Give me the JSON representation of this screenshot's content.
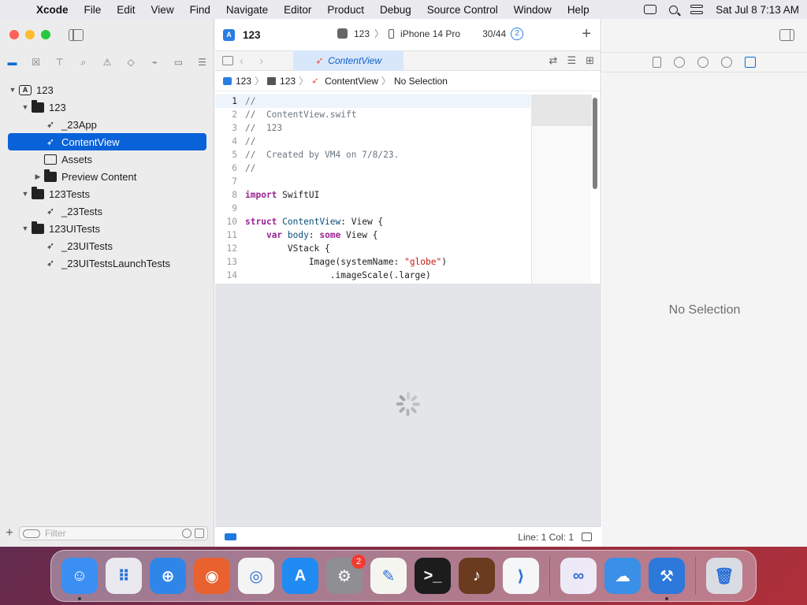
{
  "menubar": {
    "apple": "",
    "app_name": "Xcode",
    "items": [
      "File",
      "Edit",
      "View",
      "Find",
      "Navigate",
      "Editor",
      "Product",
      "Debug",
      "Source Control",
      "Window",
      "Help"
    ],
    "datetime": "Sat Jul 8  7:13 AM"
  },
  "toolbar": {
    "project_title": "123",
    "scheme": "123",
    "device": "iPhone 14 Pro",
    "progress_count": "30/44",
    "issue_badge": "2",
    "add_label": "+"
  },
  "navigator": {
    "tree": [
      {
        "label": "123",
        "type": "project",
        "level": 0,
        "disclosure": "open"
      },
      {
        "label": "123",
        "type": "folder",
        "level": 1,
        "disclosure": "open"
      },
      {
        "label": "_23App",
        "type": "swift",
        "level": 2,
        "disclosure": ""
      },
      {
        "label": "ContentView",
        "type": "swift",
        "level": 2,
        "disclosure": "",
        "selected": true
      },
      {
        "label": "Assets",
        "type": "assets",
        "level": 2,
        "disclosure": ""
      },
      {
        "label": "Preview Content",
        "type": "folder",
        "level": 2,
        "disclosure": "closed"
      },
      {
        "label": "123Tests",
        "type": "folder",
        "level": 1,
        "disclosure": "open"
      },
      {
        "label": "_23Tests",
        "type": "swift",
        "level": 2,
        "disclosure": ""
      },
      {
        "label": "123UITests",
        "type": "folder",
        "level": 1,
        "disclosure": "open"
      },
      {
        "label": "_23UITests",
        "type": "swift",
        "level": 2,
        "disclosure": ""
      },
      {
        "label": "_23UITestsLaunchTests",
        "type": "swift",
        "level": 2,
        "disclosure": ""
      }
    ],
    "filter_placeholder": "Filter",
    "add_label": "+"
  },
  "editor": {
    "tab_label": "ContentView",
    "jumpbar": [
      "123",
      "123",
      "ContentView",
      "No Selection"
    ],
    "code_lines": [
      {
        "n": "1",
        "parts": [
          {
            "t": "//",
            "c": "com"
          }
        ]
      },
      {
        "n": "2",
        "parts": [
          {
            "t": "//  ContentView.swift",
            "c": "com"
          }
        ]
      },
      {
        "n": "3",
        "parts": [
          {
            "t": "//  123",
            "c": "com"
          }
        ]
      },
      {
        "n": "4",
        "parts": [
          {
            "t": "//",
            "c": "com"
          }
        ]
      },
      {
        "n": "5",
        "parts": [
          {
            "t": "//  Created by VM4 on 7/8/23.",
            "c": "com"
          }
        ]
      },
      {
        "n": "6",
        "parts": [
          {
            "t": "//",
            "c": "com"
          }
        ]
      },
      {
        "n": "7",
        "parts": []
      },
      {
        "n": "8",
        "parts": [
          {
            "t": "import",
            "c": "kw"
          },
          {
            "t": " SwiftUI",
            "c": "pl"
          }
        ]
      },
      {
        "n": "9",
        "parts": []
      },
      {
        "n": "10",
        "parts": [
          {
            "t": "struct",
            "c": "kw"
          },
          {
            "t": " ",
            "c": "pl"
          },
          {
            "t": "ContentView",
            "c": "ty"
          },
          {
            "t": ": View {",
            "c": "pl"
          }
        ]
      },
      {
        "n": "11",
        "parts": [
          {
            "t": "    ",
            "c": "pl"
          },
          {
            "t": "var",
            "c": "kw"
          },
          {
            "t": " ",
            "c": "pl"
          },
          {
            "t": "body",
            "c": "ty"
          },
          {
            "t": ": ",
            "c": "pl"
          },
          {
            "t": "some",
            "c": "kw"
          },
          {
            "t": " View {",
            "c": "pl"
          }
        ]
      },
      {
        "n": "12",
        "parts": [
          {
            "t": "        VStack {",
            "c": "pl"
          }
        ]
      },
      {
        "n": "13",
        "parts": [
          {
            "t": "            Image(systemName: ",
            "c": "pl"
          },
          {
            "t": "\"globe\"",
            "c": "str"
          },
          {
            "t": ")",
            "c": "pl"
          }
        ]
      },
      {
        "n": "14",
        "parts": [
          {
            "t": "                .imageScale(.large)",
            "c": "pl"
          }
        ]
      }
    ],
    "status": {
      "position": "Line: 1  Col: 1"
    }
  },
  "inspector": {
    "empty_label": "No Selection"
  },
  "dock": {
    "apps": [
      {
        "name": "finder-icon",
        "color": "#3b8ff3",
        "glyph": "☺",
        "running": true
      },
      {
        "name": "launchpad-icon",
        "color": "#e9e9ef",
        "glyph": "⠿",
        "running": false
      },
      {
        "name": "safari-icon",
        "color": "#2f86e8",
        "glyph": "⊕",
        "running": false
      },
      {
        "name": "firefox-icon",
        "color": "#e8612e",
        "glyph": "◉",
        "running": false
      },
      {
        "name": "chrome-icon",
        "color": "#f4f4f4",
        "glyph": "◎",
        "running": false
      },
      {
        "name": "app-store-icon",
        "color": "#1f8bf3",
        "glyph": "A",
        "running": false
      },
      {
        "name": "system-settings-icon",
        "color": "#8e8e93",
        "glyph": "⚙",
        "running": false,
        "badge": "2"
      },
      {
        "name": "textedit-icon",
        "color": "#f5f5f0",
        "glyph": "✎",
        "running": false
      },
      {
        "name": "terminal-icon",
        "color": "#1c1c1c",
        "glyph": ">_",
        "running": false
      },
      {
        "name": "garageband-icon",
        "color": "#6b3b1f",
        "glyph": "♪",
        "running": false
      },
      {
        "name": "vscode-icon",
        "color": "#f4f6f8",
        "glyph": "⟩",
        "running": false
      },
      {
        "name": "visual-studio-icon",
        "color": "#eee9f7",
        "glyph": "∞",
        "running": false
      },
      {
        "name": "weather-icon",
        "color": "#3a8fe6",
        "glyph": "☁",
        "running": false
      },
      {
        "name": "xcode-icon",
        "color": "#2d78db",
        "glyph": "⚒",
        "running": true
      },
      {
        "name": "trash-icon",
        "color": "#d9dde3",
        "glyph": "🗑",
        "running": false
      }
    ]
  },
  "colors": {
    "selection": "#0a62d8",
    "accent": "#0a6dd9",
    "swift": "#f05138"
  }
}
